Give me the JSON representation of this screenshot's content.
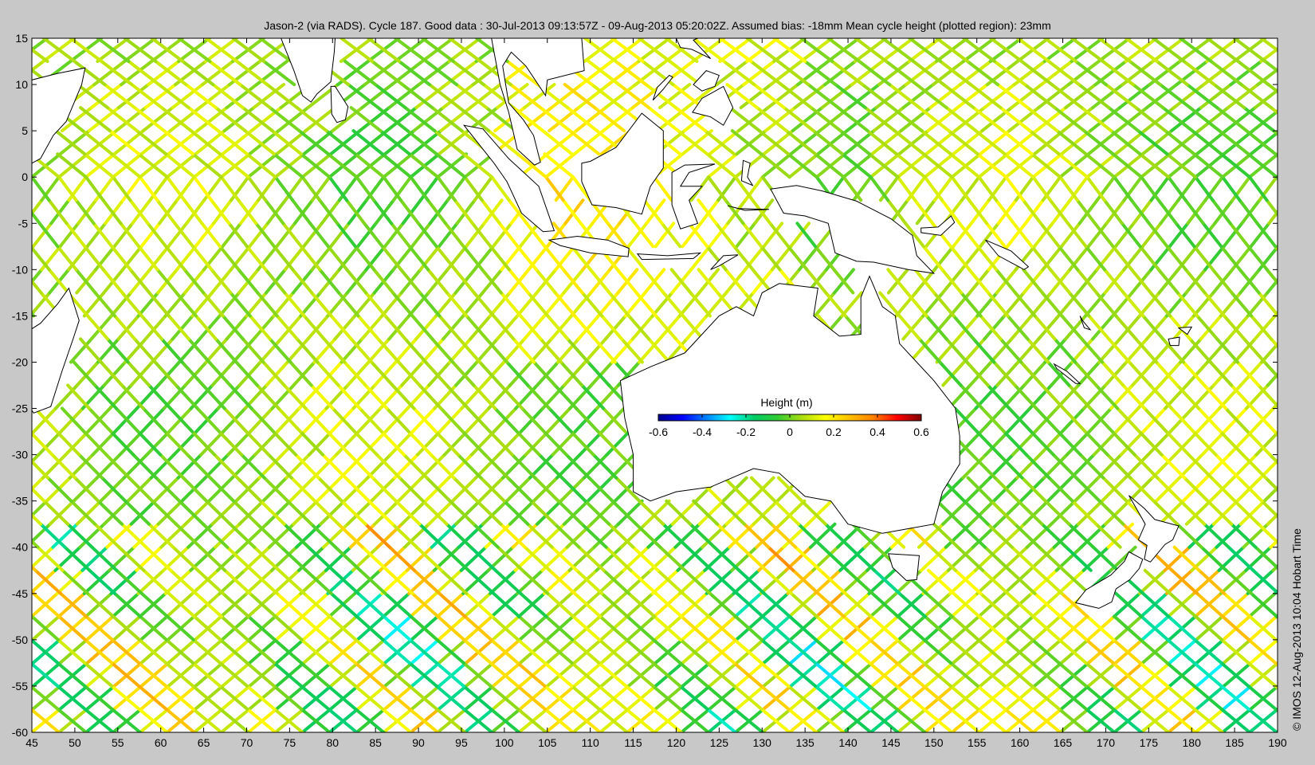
{
  "title": "Jason-2 (via RADS). Cycle 187. Good data : 30-Jul-2013 09:13:57Z - 09-Aug-2013 05:20:02Z. Assumed bias: -18mm  Mean cycle height (plotted region): 23mm",
  "credit": "© IMOS 12-Aug-2013 10:04 Hobart Time",
  "map": {
    "lon_range": [
      45,
      190
    ],
    "lat_range": [
      -60,
      15
    ],
    "lon_ticks": [
      45,
      50,
      55,
      60,
      65,
      70,
      75,
      80,
      85,
      90,
      95,
      100,
      105,
      110,
      115,
      120,
      125,
      130,
      135,
      140,
      145,
      150,
      155,
      160,
      165,
      170,
      175,
      180,
      185,
      190
    ],
    "lat_ticks": [
      15,
      10,
      5,
      0,
      -5,
      -10,
      -15,
      -20,
      -25,
      -30,
      -35,
      -40,
      -45,
      -50,
      -55,
      -60
    ],
    "lon_tick_labels": [
      "45",
      "50",
      "55",
      "60",
      "65",
      "70",
      "75",
      "80",
      "85",
      "90",
      "95",
      "100",
      "105",
      "110",
      "115",
      "120",
      "125",
      "130",
      "135",
      "140",
      "145",
      "150",
      "155",
      "160",
      "165",
      "170",
      "175",
      "180",
      "185",
      "190"
    ],
    "lat_tick_labels": [
      "15",
      "10",
      "5",
      "0",
      "-5",
      "-10",
      "-15",
      "-20",
      "-25",
      "-30",
      "-35",
      "-40",
      "-45",
      "-50",
      "-55",
      "-60"
    ]
  },
  "colorbar": {
    "label": "Height (m)",
    "range": [
      -0.6,
      0.6
    ],
    "tick_values": [
      -0.6,
      -0.4,
      -0.2,
      0,
      0.2,
      0.4,
      0.6
    ],
    "tick_labels": [
      "-0.6",
      "-0.4",
      "-0.2",
      "0",
      "0.2",
      "0.4",
      "0.6"
    ],
    "colormap": [
      "#00008f",
      "#0000ff",
      "#0080ff",
      "#00ffff",
      "#00cc66",
      "#33cc33",
      "#aadd11",
      "#ffff00",
      "#ffbf00",
      "#ff8000",
      "#ff0000",
      "#800000"
    ]
  },
  "colors": {
    "background": "#c8c8c8",
    "ocean": "#ffffff",
    "land": "#ffffff",
    "coast": "#000000"
  }
}
